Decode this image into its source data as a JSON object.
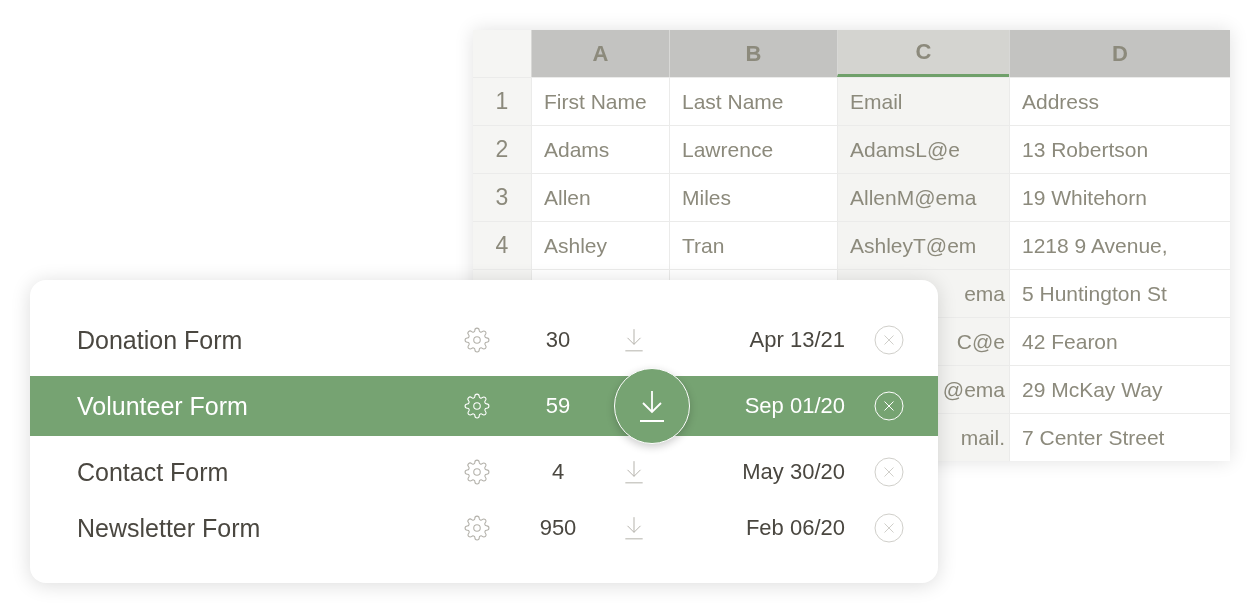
{
  "spreadsheet": {
    "columns": [
      {
        "label": "A",
        "selected": false
      },
      {
        "label": "B",
        "selected": false
      },
      {
        "label": "C",
        "selected": true
      },
      {
        "label": "D",
        "selected": false
      }
    ],
    "rows": [
      {
        "number": "1",
        "cells": [
          "First Name",
          "Last Name",
          "Email",
          "Address"
        ]
      },
      {
        "number": "2",
        "cells": [
          "Adams",
          "Lawrence",
          "AdamsL@e",
          "13 Robertson"
        ]
      },
      {
        "number": "3",
        "cells": [
          "Allen",
          "Miles",
          "AllenM@ema",
          "19 Whitehorn"
        ]
      },
      {
        "number": "4",
        "cells": [
          "Ashley",
          "Tran",
          "AshleyT@em",
          "1218 9 Avenue,"
        ]
      },
      {
        "cells": [
          null,
          null,
          "ema",
          "5 Huntington St"
        ]
      },
      {
        "cells": [
          null,
          null,
          "C@e",
          "42 Fearon"
        ]
      },
      {
        "cells": [
          null,
          null,
          "@ema",
          "29 McKay Way"
        ]
      },
      {
        "cells": [
          null,
          null,
          "mail.",
          "7 Center Street"
        ]
      }
    ]
  },
  "forms": [
    {
      "name": "Donation Form",
      "count": "30",
      "date": "Apr 13/21",
      "selected": false
    },
    {
      "name": "Volunteer Form",
      "count": "59",
      "date": "Sep 01/20",
      "selected": true
    },
    {
      "name": "Contact Form",
      "count": "4",
      "date": "May 30/20",
      "selected": false
    },
    {
      "name": "Newsletter Form",
      "count": "950",
      "date": "Feb 06/20",
      "selected": false
    }
  ]
}
